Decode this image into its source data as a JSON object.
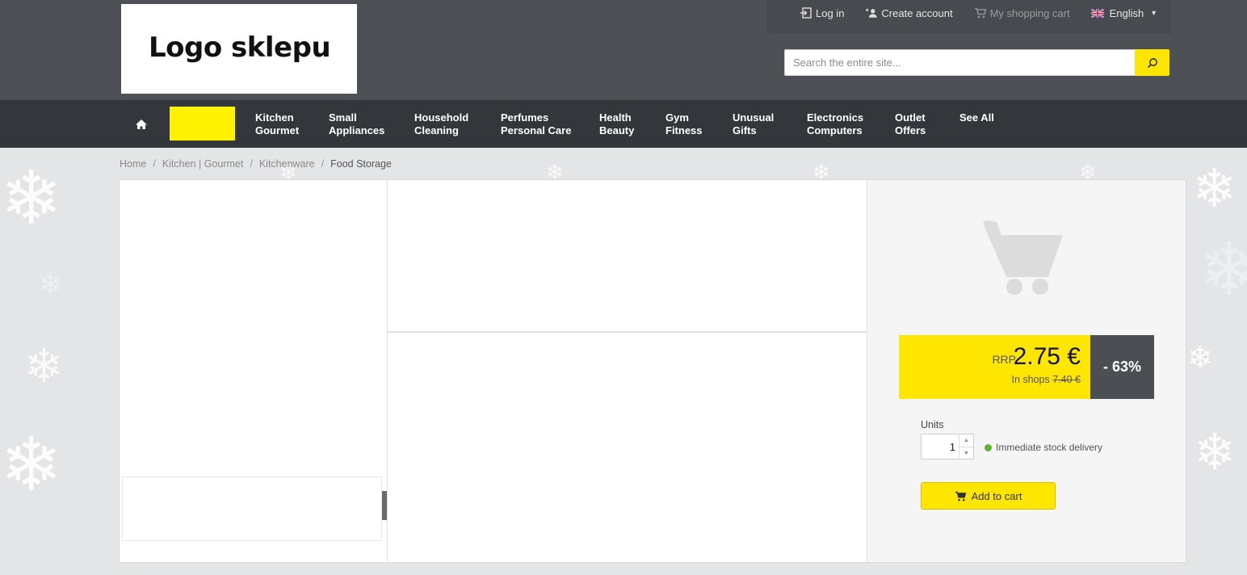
{
  "header": {
    "logo_text": "Logo sklepu",
    "links": {
      "login": "Log in",
      "create_account": "Create account",
      "cart": "My shopping cart",
      "language": "English"
    },
    "search": {
      "placeholder": "Search the entire site..."
    }
  },
  "nav": {
    "items": [
      {
        "line1": "Kitchen",
        "line2": "Gourmet"
      },
      {
        "line1": "Small",
        "line2": "Appliances"
      },
      {
        "line1": "Household",
        "line2": "Cleaning"
      },
      {
        "line1": "Perfumes",
        "line2": "Personal Care"
      },
      {
        "line1": "Health",
        "line2": "Beauty"
      },
      {
        "line1": "Gym",
        "line2": "Fitness"
      },
      {
        "line1": "Unusual",
        "line2": "Gifts"
      },
      {
        "line1": "Electronics",
        "line2": "Computers"
      },
      {
        "line1": "Outlet",
        "line2": "Offers"
      },
      {
        "line1": "See All",
        "line2": ""
      }
    ]
  },
  "breadcrumb": {
    "items": [
      "Home",
      "Kitchen | Gourmet",
      "Kitchenware"
    ],
    "separator": "/",
    "current": "Food Storage"
  },
  "product": {
    "rrp_label": "RRP",
    "price": "2.75 €",
    "in_shops_label": "In shops",
    "old_price": "7.40 €",
    "discount": "- 63%",
    "units_label": "Units",
    "quantity": "1",
    "stock_text": "Immediate stock delivery",
    "add_to_cart": "Add to cart"
  },
  "colors": {
    "accent": "#ffe600",
    "header_bg": "#4d5155",
    "nav_bg": "#33373b",
    "discount_bg": "#4b4e52",
    "stock_ok": "#5cb531"
  }
}
